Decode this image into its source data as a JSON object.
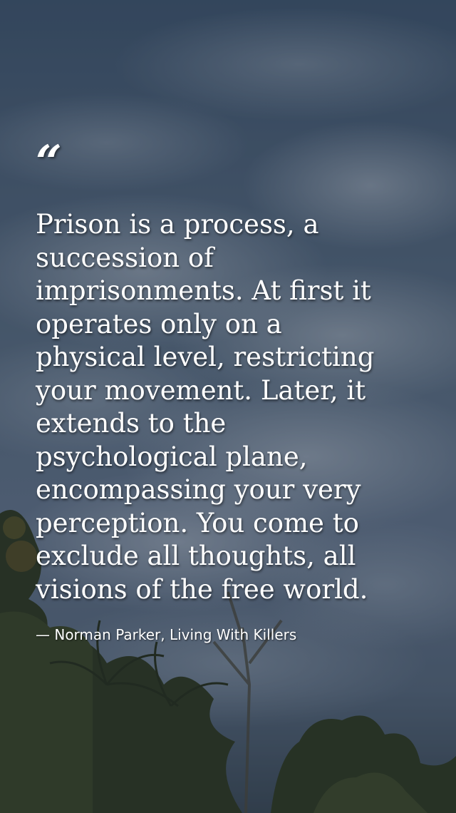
{
  "background": {
    "description_icon": "sky-with-clouds-and-palm-trees",
    "sky_color": "#4d6278",
    "foliage_color": "#2e3a22"
  },
  "quote": {
    "mark": "“",
    "lines": [
      "Prison is a process, a",
      "succession of",
      "imprisonments. At first it",
      "operates only on a",
      "physical level, restricting",
      "your movement. Later, it",
      "extends to the",
      "psychological plane,",
      "encompassing your very",
      "perception. You come to",
      "exclude all thoughts, all",
      "visions of the free world."
    ],
    "attribution": "— Norman Parker, Living With Killers"
  }
}
